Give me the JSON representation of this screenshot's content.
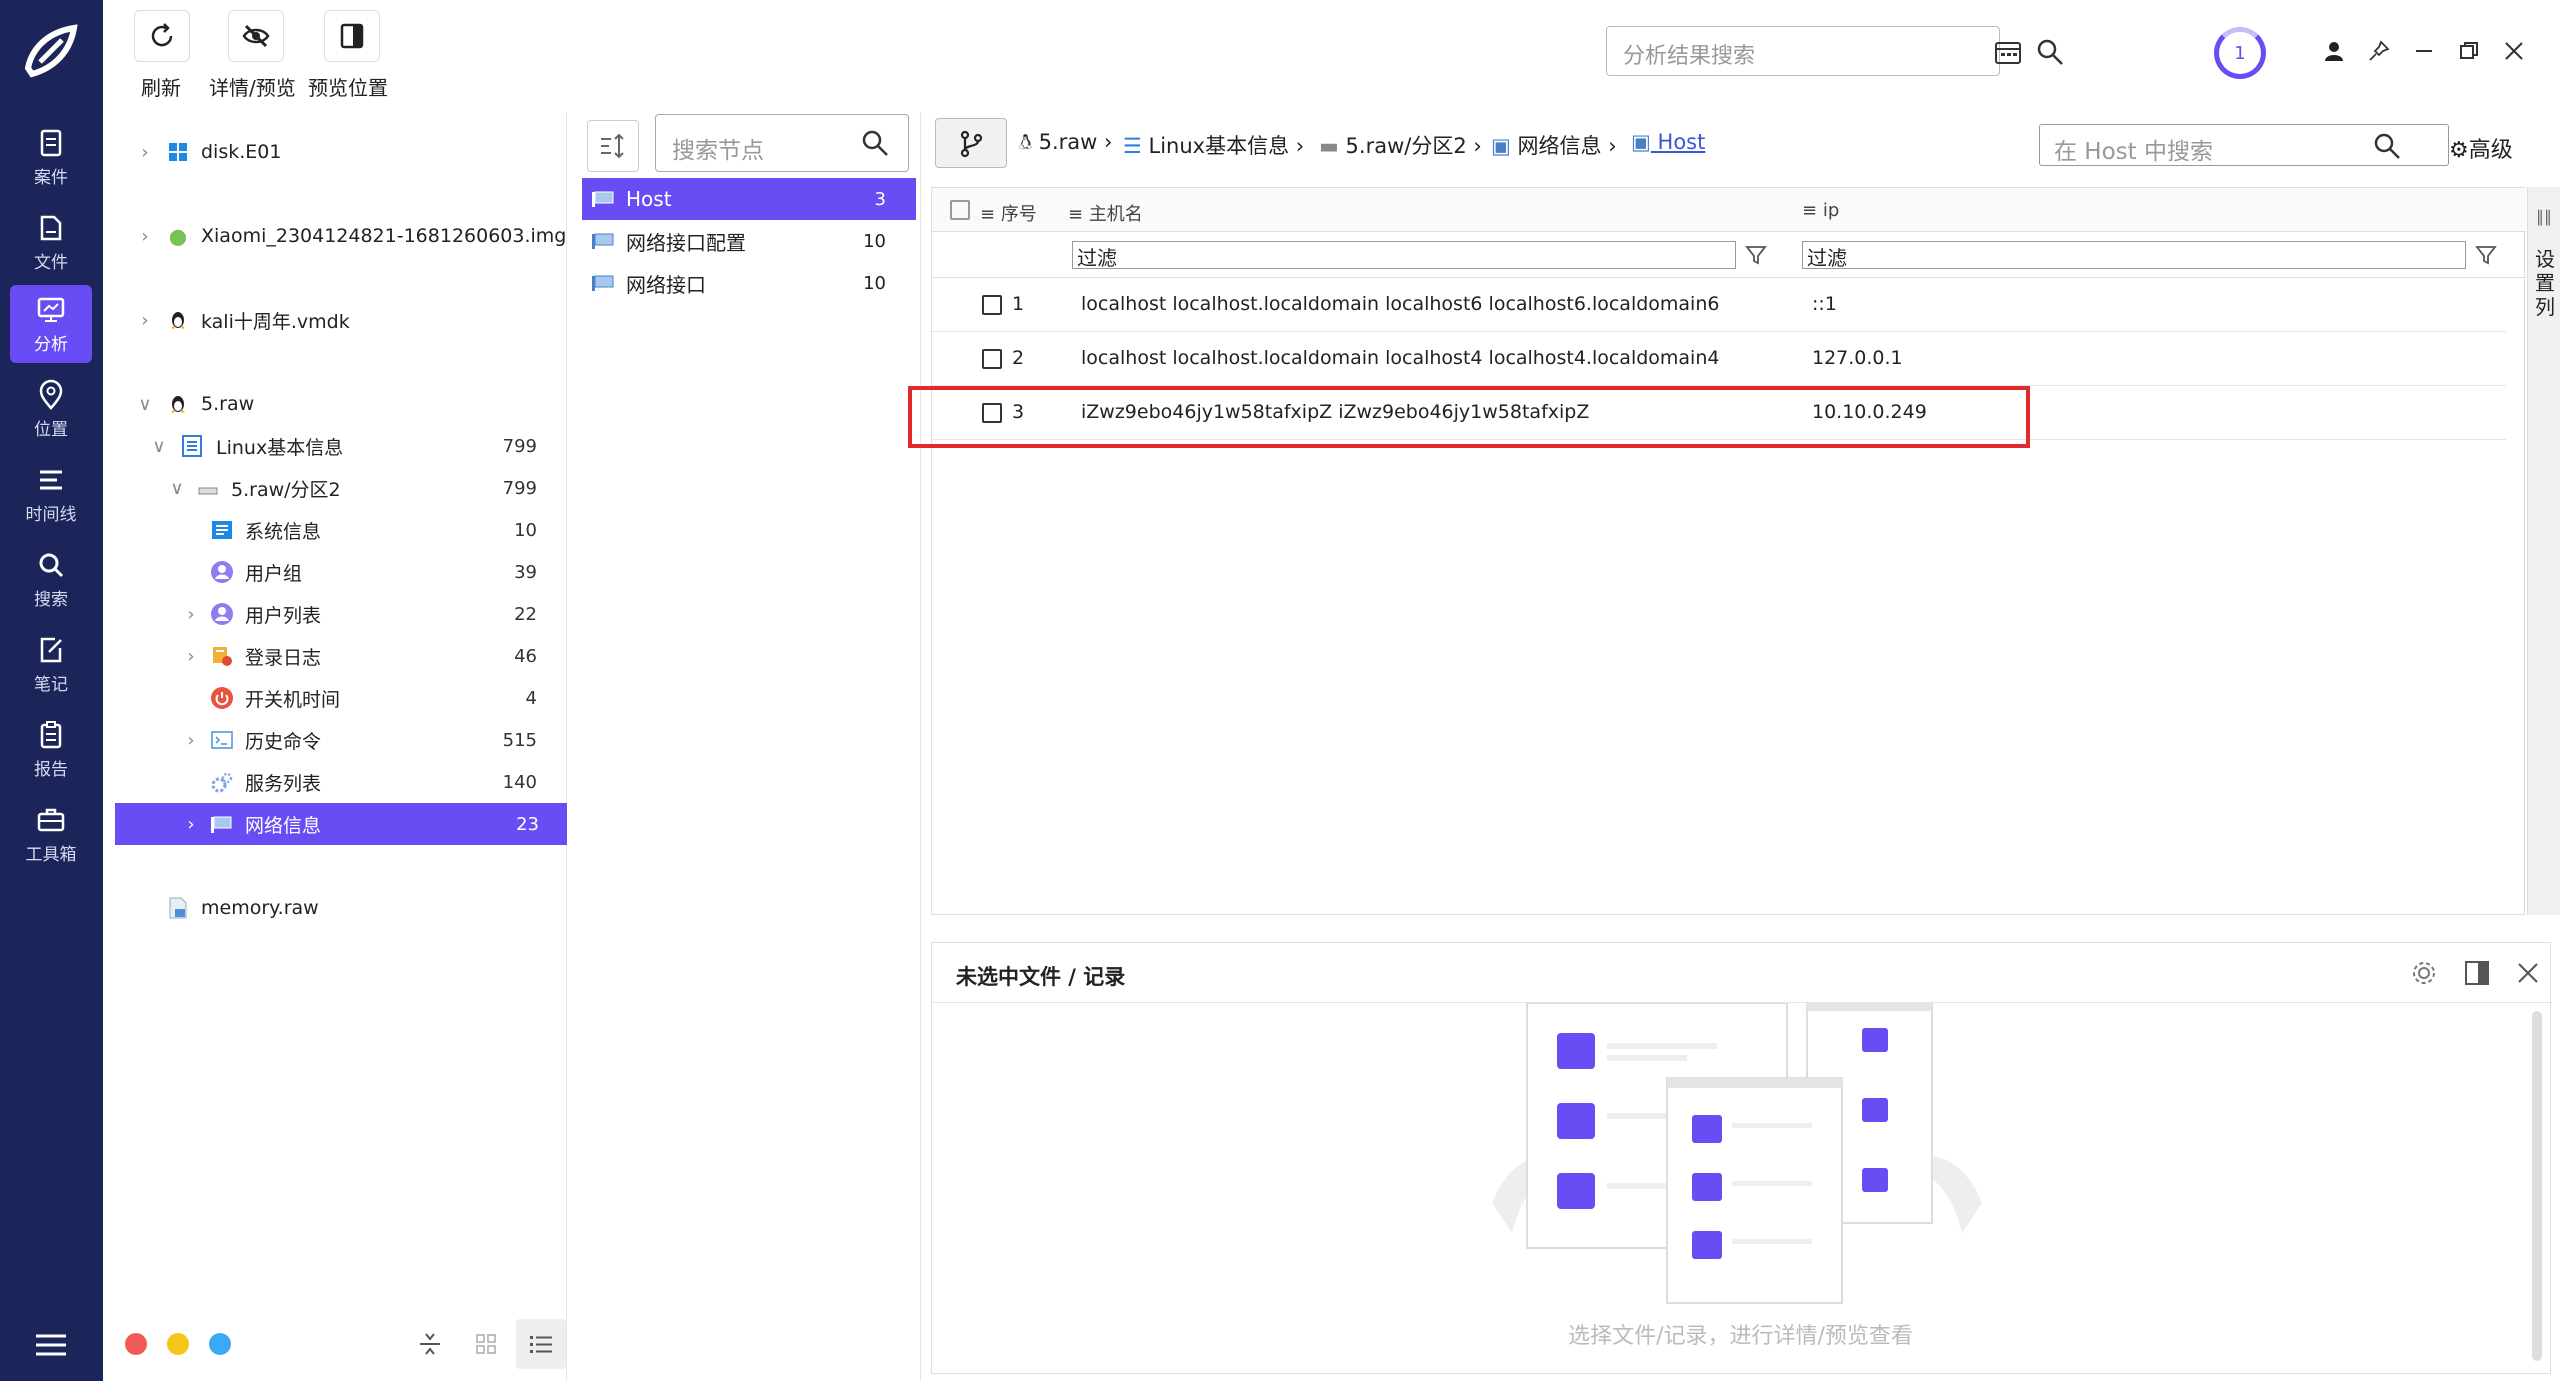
{
  "nav": {
    "items": [
      {
        "label": "案件",
        "icon": "case-icon"
      },
      {
        "label": "文件",
        "icon": "file-icon"
      },
      {
        "label": "分析",
        "icon": "analysis-icon",
        "active": true
      },
      {
        "label": "位置",
        "icon": "location-icon"
      },
      {
        "label": "时间线",
        "icon": "timeline-icon"
      },
      {
        "label": "搜索",
        "icon": "search-icon"
      },
      {
        "label": "笔记",
        "icon": "notes-icon"
      },
      {
        "label": "报告",
        "icon": "report-icon"
      },
      {
        "label": "工具箱",
        "icon": "toolbox-icon"
      }
    ]
  },
  "toolbar": {
    "refresh_label": "刷新",
    "detail_label": "详情/预览",
    "preview_pos_label": "预览位置",
    "search_placeholder": "分析结果搜索",
    "task_count": "1"
  },
  "tree": {
    "items": [
      {
        "label": "disk.E01",
        "count": ""
      },
      {
        "label": "Xiaomi_2304124821-1681260603.img",
        "count": ""
      },
      {
        "label": "kali十周年.vmdk",
        "count": ""
      },
      {
        "label": "5.raw",
        "count": ""
      },
      {
        "label": "Linux基本信息",
        "count": "799"
      },
      {
        "label": "5.raw/分区2",
        "count": "799"
      },
      {
        "label": "系统信息",
        "count": "10"
      },
      {
        "label": "用户组",
        "count": "39"
      },
      {
        "label": "用户列表",
        "count": "22"
      },
      {
        "label": "登录日志",
        "count": "46"
      },
      {
        "label": "开关机时间",
        "count": "4"
      },
      {
        "label": "历史命令",
        "count": "515"
      },
      {
        "label": "服务列表",
        "count": "140"
      },
      {
        "label": "网络信息",
        "count": "23"
      },
      {
        "label": "memory.raw",
        "count": ""
      }
    ]
  },
  "nodes": {
    "search_placeholder": "搜索节点",
    "items": [
      {
        "label": "Host",
        "count": "3"
      },
      {
        "label": "网络接口配置",
        "count": "10"
      },
      {
        "label": "网络接口",
        "count": "10"
      }
    ]
  },
  "breadcrumb": {
    "items": [
      "5.raw",
      "Linux基本信息",
      "5.raw/分区2",
      "网络信息",
      "Host"
    ],
    "search_placeholder": "在 Host 中搜索",
    "advanced_label": "高级"
  },
  "grid": {
    "headers": {
      "seq": "序号",
      "host": "主机名",
      "ip": "ip"
    },
    "filter_placeholder": "过滤",
    "column_settings": "设置列",
    "rows": [
      {
        "num": "1",
        "host": "localhost localhost.localdomain localhost6 localhost6.localdomain6",
        "ip": "::1"
      },
      {
        "num": "2",
        "host": "localhost localhost.localdomain localhost4 localhost4.localdomain4",
        "ip": "127.0.0.1"
      },
      {
        "num": "3",
        "host": "iZwz9ebo46jy1w58tafxipZ iZwz9ebo46jy1w58tafxipZ",
        "ip": "10.10.0.249"
      }
    ]
  },
  "preview": {
    "title": "未选中文件 / 记录",
    "empty_text": "选择文件/记录，进行详情/预览查看"
  },
  "colors": {
    "accent": "#6a4cf5",
    "rail": "#1b2559",
    "highlight": "#e12a2a"
  }
}
